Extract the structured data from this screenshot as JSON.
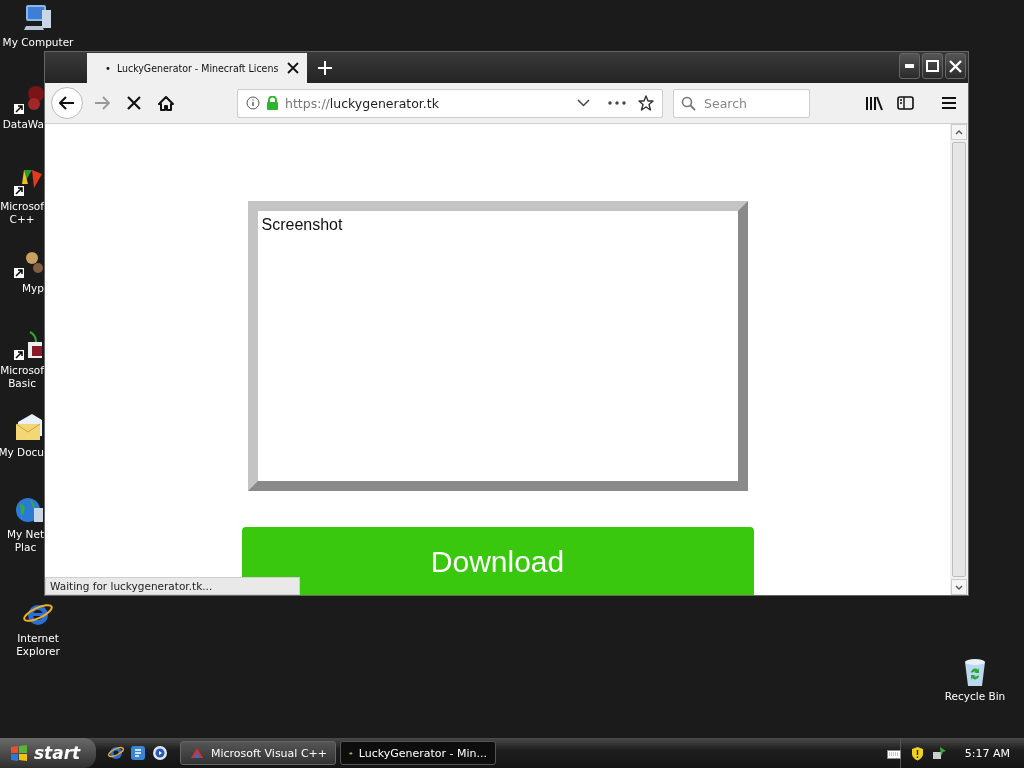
{
  "desktop_icons": [
    {
      "lines": [
        "My Computer"
      ],
      "kind": "full"
    },
    {
      "lines": [
        "DataWa"
      ],
      "kind": "partial"
    },
    {
      "lines": [
        "Microsof",
        "C++"
      ],
      "kind": "partial"
    },
    {
      "lines": [
        "Myp"
      ],
      "kind": "partial"
    },
    {
      "lines": [
        "Microsof",
        "Basic"
      ],
      "kind": "partial"
    },
    {
      "lines": [
        "My Docu"
      ],
      "kind": "partial"
    },
    {
      "lines": [
        "My Net",
        "Plac"
      ],
      "kind": "partial"
    },
    {
      "lines": [
        "Internet",
        "Explorer"
      ],
      "kind": "full"
    }
  ],
  "recycle_bin": {
    "lines": [
      "Recycle Bin"
    ]
  },
  "browser": {
    "tabs": [
      {
        "marker": "•",
        "title": "LuckyGenerator - Minecraft Licens",
        "selected": true
      }
    ],
    "address": {
      "scheme": "https://",
      "host": "luckygenerator.tk"
    },
    "search": {
      "placeholder": "Search"
    },
    "page": {
      "frame_label": "Screenshot",
      "button": "Download"
    },
    "status": "Waiting for luckygenerator.tk..."
  },
  "taskbar": {
    "start": "start",
    "tasks": [
      {
        "label": "Microsoft Visual C++",
        "selected": false
      },
      {
        "label": "LuckyGenerator - Min...",
        "selected": true
      }
    ],
    "clock": "5:17 AM"
  }
}
